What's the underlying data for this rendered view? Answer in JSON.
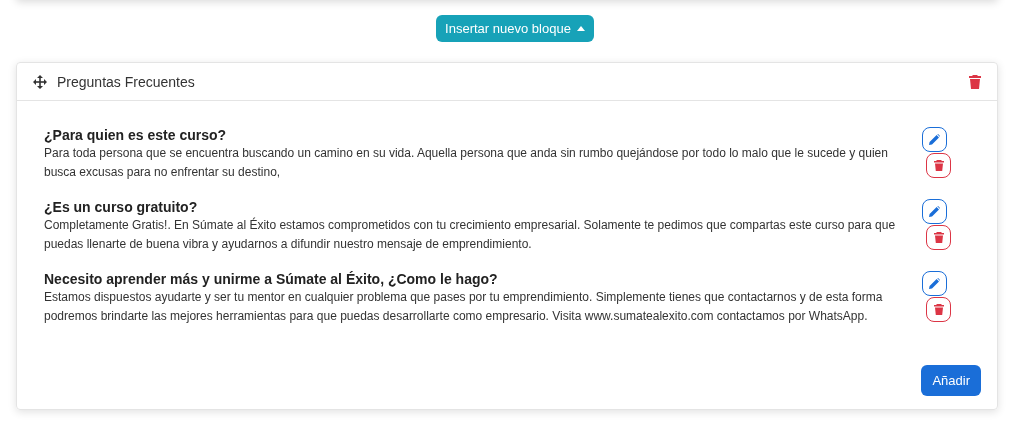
{
  "insert_button": {
    "label": "Insertar nuevo bloque"
  },
  "block": {
    "title": "Preguntas Frecuentes",
    "faqs": [
      {
        "question": "¿Para quien es este curso?",
        "answer": "Para toda persona que se encuentra buscando un camino en su vida. Aquella persona que anda sin rumbo quejándose por todo lo malo que le sucede y quien busca excusas para no enfrentar su destino,"
      },
      {
        "question": "¿Es un curso gratuito?",
        "answer": "Completamente Gratis!. En Súmate al Éxito estamos comprometidos con tu crecimiento empresarial. Solamente te pedimos que compartas este curso para que puedas llenarte de buena vibra y ayudarnos a difundir nuestro mensaje de emprendimiento."
      },
      {
        "question": "Necesito aprender más y unirme a Súmate al Éxito, ¿Como le hago?",
        "answer": "Estamos dispuestos ayudarte y ser tu mentor en cualquier problema que pases por tu emprendimiento. Simplemente tienes que contactarnos y de esta forma podremos brindarte las mejores herramientas para que puedas desarrollarte como empresario. Visita www.sumatealexito.com contactamos por WhatsApp."
      }
    ],
    "add_button": {
      "label": "Añadir"
    }
  }
}
